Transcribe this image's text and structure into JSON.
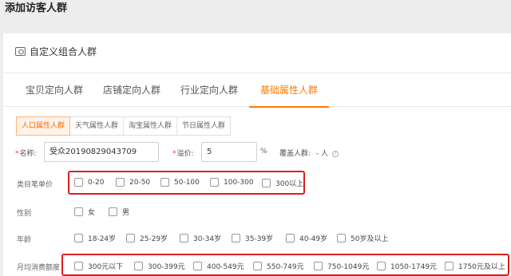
{
  "page": {
    "title": "添加访客人群"
  },
  "card": {
    "header": "自定义组合人群"
  },
  "tabs": [
    {
      "label": "宝贝定向人群"
    },
    {
      "label": "店铺定向人群"
    },
    {
      "label": "行业定向人群"
    },
    {
      "label": "基础属性人群"
    }
  ],
  "subtabs": [
    {
      "label": "人口属性人群"
    },
    {
      "label": "天气属性人群"
    },
    {
      "label": "淘宝属性人群"
    },
    {
      "label": "节日属性人群"
    }
  ],
  "form": {
    "name_label": "名称:",
    "name_value": "受众20190829043709",
    "premium_label": "溢价:",
    "premium_value": "5",
    "premium_unit": "%",
    "coverage_label": "覆盖人群:",
    "coverage_value": "- 人",
    "help": "?"
  },
  "category_price": {
    "label": "类目笔单价",
    "options": [
      "0-20",
      "20-50",
      "50-100",
      "100-300",
      "300以上"
    ]
  },
  "gender": {
    "label": "性别",
    "options": [
      "女",
      "男"
    ]
  },
  "age": {
    "label": "年龄",
    "options": [
      "18-24岁",
      "25-29岁",
      "30-34岁",
      "35-39岁",
      "40-49岁",
      "50岁及以上"
    ]
  },
  "monthly_spend": {
    "label": "月均消费额度",
    "options": [
      "300元以下",
      "300-399元",
      "400-549元",
      "550-749元",
      "750-1049元",
      "1050-1749元",
      "1750元及以上"
    ]
  }
}
